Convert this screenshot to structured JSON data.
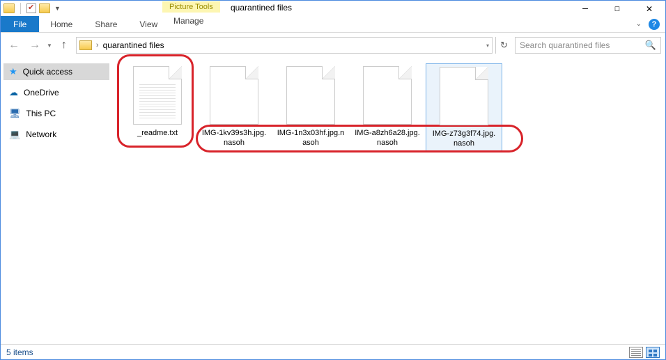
{
  "window": {
    "title": "quarantined files",
    "picture_tools_label": "Picture Tools"
  },
  "ribbon": {
    "file": "File",
    "tabs": [
      "Home",
      "Share",
      "View"
    ],
    "manage": "Manage"
  },
  "address": {
    "path": "quarantined files"
  },
  "search": {
    "placeholder": "Search quarantined files"
  },
  "sidebar": {
    "items": [
      {
        "label": "Quick access",
        "icon": "star"
      },
      {
        "label": "OneDrive",
        "icon": "cloud"
      },
      {
        "label": "This PC",
        "icon": "pc"
      },
      {
        "label": "Network",
        "icon": "net"
      }
    ]
  },
  "files": [
    {
      "name": "_readme.txt",
      "lines": true
    },
    {
      "name": "IMG-1kv39s3h.jpg.nasoh"
    },
    {
      "name": "IMG-1n3x03hf.jpg.nasoh"
    },
    {
      "name": "IMG-a8zh6a28.jpg.nasoh"
    },
    {
      "name": "IMG-z73g3f74.jpg.nasoh",
      "selected": true
    }
  ],
  "status": {
    "count_label": "5 items"
  }
}
